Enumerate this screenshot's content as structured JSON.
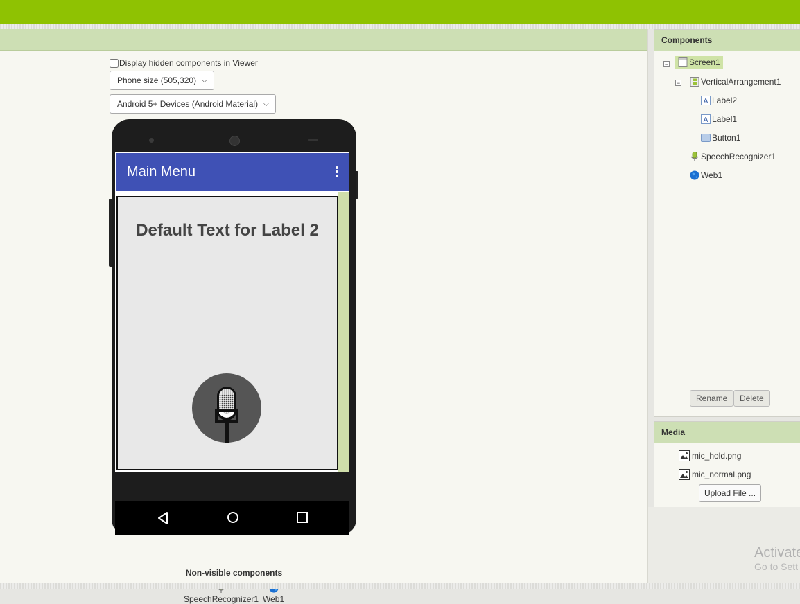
{
  "viewer": {
    "hidden_checkbox_label": "Display hidden components in Viewer",
    "phone_size": "Phone size (505,320)",
    "theme": "Android 5+ Devices (Android Material)",
    "app_title": "Main Menu",
    "label2_text": "Default Text for Label 2",
    "label1_text": "",
    "nonvisible_title": "Non-visible components",
    "nonvisible_items": [
      "SpeechRecognizer1",
      "Web1"
    ]
  },
  "components": {
    "title": "Components",
    "tree": {
      "screen": "Screen1",
      "vertical_arrangement": "VerticalArrangement1",
      "label2": "Label2",
      "label1": "Label1",
      "button1": "Button1",
      "speech": "SpeechRecognizer1",
      "web": "Web1"
    },
    "rename_label": "Rename",
    "delete_label": "Delete"
  },
  "media": {
    "title": "Media",
    "files": [
      "mic_hold.png",
      "mic_normal.png"
    ],
    "upload_label": "Upload File ..."
  },
  "watermark": {
    "line1": "Activate",
    "line2": "Go to Sett"
  },
  "colors": {
    "topbar": "#8fc202",
    "panel_header": "#cddfb4",
    "appbar": "#3f51b5",
    "selected": "#cfe3a6"
  }
}
